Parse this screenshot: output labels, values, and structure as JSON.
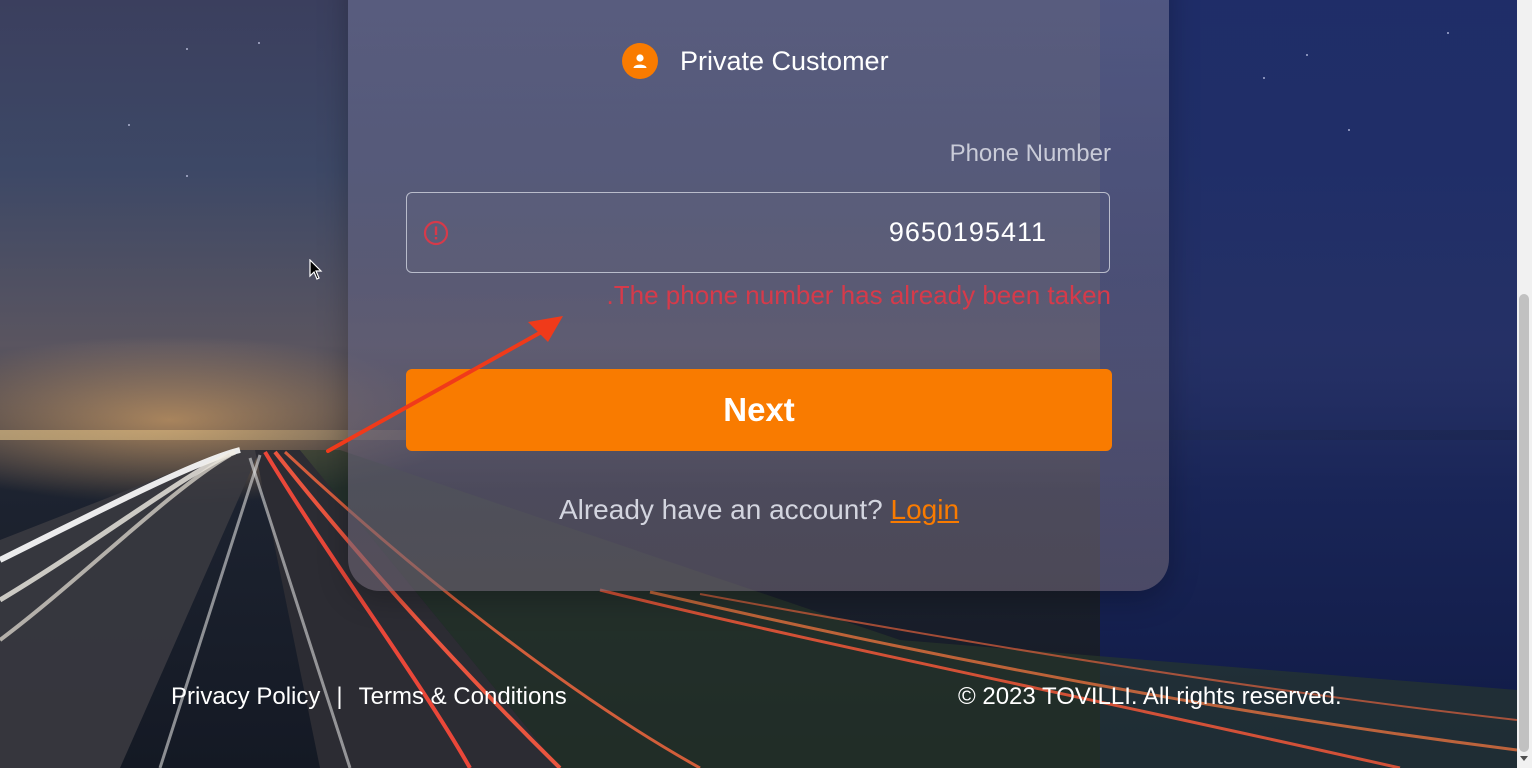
{
  "customer_type": {
    "label": "Private Customer",
    "icon": "person-icon"
  },
  "form": {
    "phone_label": "Phone Number",
    "phone_value": "9650195411",
    "error_icon": "error-circle-icon",
    "error_message": ".The phone number has already been taken",
    "next_label": "Next"
  },
  "login_prompt": {
    "text": "Already have an account?",
    "link_label": "Login"
  },
  "footer": {
    "privacy_label": "Privacy Policy",
    "separator": "|",
    "terms_label": "Terms & Conditions",
    "copyright": "© 2023 TOVILLI. All rights reserved."
  },
  "colors": {
    "accent": "#f97b00",
    "error": "#d63a4a",
    "annotation_arrow": "#f03a1a"
  }
}
